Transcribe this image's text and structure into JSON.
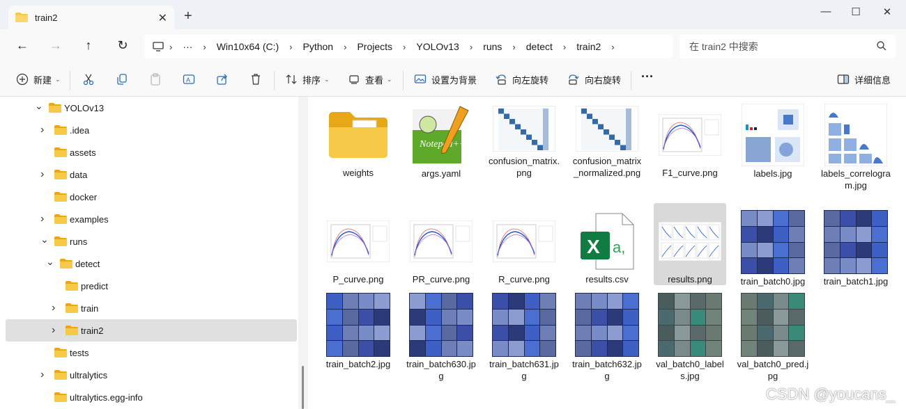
{
  "window": {
    "tab_title": "train2",
    "new_tab": "+",
    "minimize": "—",
    "maximize": "☐",
    "close": "✕"
  },
  "nav": {
    "back": "←",
    "forward": "→",
    "up": "↑",
    "refresh": "↻"
  },
  "address": {
    "more": "···",
    "segments": [
      "Win10x64 (C:)",
      "Python",
      "Projects",
      "YOLOv13",
      "runs",
      "detect",
      "train2"
    ]
  },
  "search": {
    "placeholder": "在 train2 中搜索"
  },
  "toolbar": {
    "new": "新建",
    "sort": "排序",
    "view": "查看",
    "set_background": "设置为背景",
    "rotate_left": "向左旋转",
    "rotate_right": "向右旋转",
    "more": "···",
    "details": "详细信息"
  },
  "sidebar": {
    "items": [
      {
        "label": "YOLOv13",
        "expanded": true
      },
      {
        "label": ".idea"
      },
      {
        "label": "assets"
      },
      {
        "label": "data"
      },
      {
        "label": "docker"
      },
      {
        "label": "examples"
      },
      {
        "label": "runs",
        "expanded": true
      },
      {
        "label": "detect",
        "expanded": true
      },
      {
        "label": "predict"
      },
      {
        "label": "train"
      },
      {
        "label": "train2",
        "selected": true
      },
      {
        "label": "tests"
      },
      {
        "label": "ultralytics"
      },
      {
        "label": "ultralytics.egg-info"
      }
    ]
  },
  "files": [
    {
      "name": "weights",
      "kind": "folder"
    },
    {
      "name": "args.yaml",
      "kind": "notepad"
    },
    {
      "name": "confusion_matrix.png",
      "kind": "matrix"
    },
    {
      "name": "confusion_matrix_normalized.png",
      "kind": "matrix"
    },
    {
      "name": "F1_curve.png",
      "kind": "curve"
    },
    {
      "name": "labels.jpg",
      "kind": "labels"
    },
    {
      "name": "labels_correlogram.jpg",
      "kind": "correlogram"
    },
    {
      "name": "P_curve.png",
      "kind": "curve"
    },
    {
      "name": "PR_curve.png",
      "kind": "curve"
    },
    {
      "name": "R_curve.png",
      "kind": "curve"
    },
    {
      "name": "results.csv",
      "kind": "excel"
    },
    {
      "name": "results.png",
      "kind": "results",
      "selected": true
    },
    {
      "name": "train_batch0.jpg",
      "kind": "batch"
    },
    {
      "name": "train_batch1.jpg",
      "kind": "batch"
    },
    {
      "name": "train_batch2.jpg",
      "kind": "batch"
    },
    {
      "name": "train_batch630.jpg",
      "kind": "batch"
    },
    {
      "name": "train_batch631.jpg",
      "kind": "batch"
    },
    {
      "name": "train_batch632.jpg",
      "kind": "batch"
    },
    {
      "name": "val_batch0_labels.jpg",
      "kind": "valbatch"
    },
    {
      "name": "val_batch0_pred.jpg",
      "kind": "valbatch"
    }
  ],
  "watermark": "CSDN @youcans_",
  "colors": {
    "folder": "#f7c948",
    "folder_dark": "#e6a817",
    "excel_green": "#107c41",
    "selection": "#d9d9d9"
  }
}
